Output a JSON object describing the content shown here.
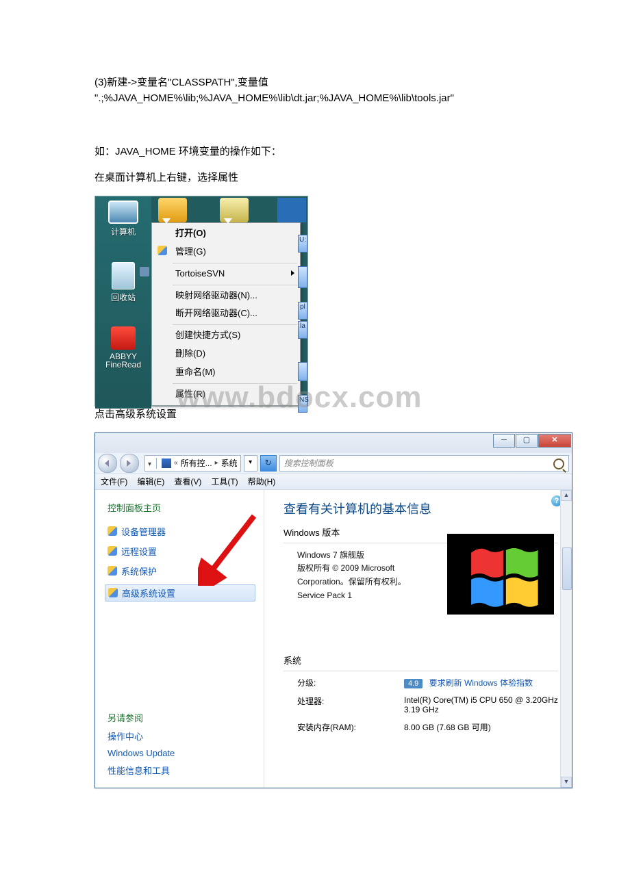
{
  "doc": {
    "line1": "(3)新建->变量名\"CLASSPATH\",变量值",
    "line2": "\".;%JAVA_HOME%\\lib;%JAVA_HOME%\\lib\\dt.jar;%JAVA_HOME%\\lib\\tools.jar\"",
    "step_intro": "如：JAVA_HOME 环境变量的操作如下：",
    "step_right_click": "在桌面计算机上右键，选择属性",
    "click_advanced": "点击高级系统设置",
    "watermark": "www.bdocx.com"
  },
  "desktop": {
    "computer": "计算机",
    "bin": "回收站",
    "abbyy1": "ABBYY",
    "abbyy2": "FineRead"
  },
  "ctxmenu": {
    "open": "打开(O)",
    "manage": "管理(G)",
    "svn": "TortoiseSVN",
    "map": "映射网络驱动器(N)...",
    "disconnect": "断开网络驱动器(C)...",
    "shortcut": "创建快捷方式(S)",
    "delete": "删除(D)",
    "rename": "重命名(M)",
    "properties": "属性(R)"
  },
  "rightslice": {
    "a": "U:",
    "b": "",
    "c": "pl",
    "d": "la",
    "e": "",
    "f": "NS"
  },
  "syswin": {
    "crumb_all": "所有控...",
    "crumb_sys": "系统",
    "search_ph": "搜索控制面板",
    "menus": {
      "file": "文件(F)",
      "edit": "编辑(E)",
      "view": "查看(V)",
      "tools": "工具(T)",
      "help": "帮助(H)"
    },
    "left": {
      "home": "控制面板主页",
      "dev": "设备管理器",
      "remote": "远程设置",
      "protect": "系统保护",
      "advanced": "高级系统设置",
      "see_also": "另请参阅",
      "action": "操作中心",
      "wu": "Windows Update",
      "perf": "性能信息和工具"
    },
    "right": {
      "title": "查看有关计算机的基本信息",
      "win_ver": "Windows 版本",
      "edition": "Windows 7 旗舰版",
      "copyright": "版权所有 © 2009 Microsoft Corporation。保留所有权利。",
      "sp": "Service Pack 1",
      "system": "系统",
      "rating_lbl": "分级:",
      "rating_val": "4.9",
      "rating_link": "要求刷新 Windows 体验指数",
      "cpu_lbl": "处理器:",
      "cpu_val": "Intel(R) Core(TM) i5 CPU 650  @ 3.20GHz   3.19 GHz",
      "ram_lbl": "安装内存(RAM):",
      "ram_val": "8.00 GB (7.68 GB 可用)"
    }
  }
}
